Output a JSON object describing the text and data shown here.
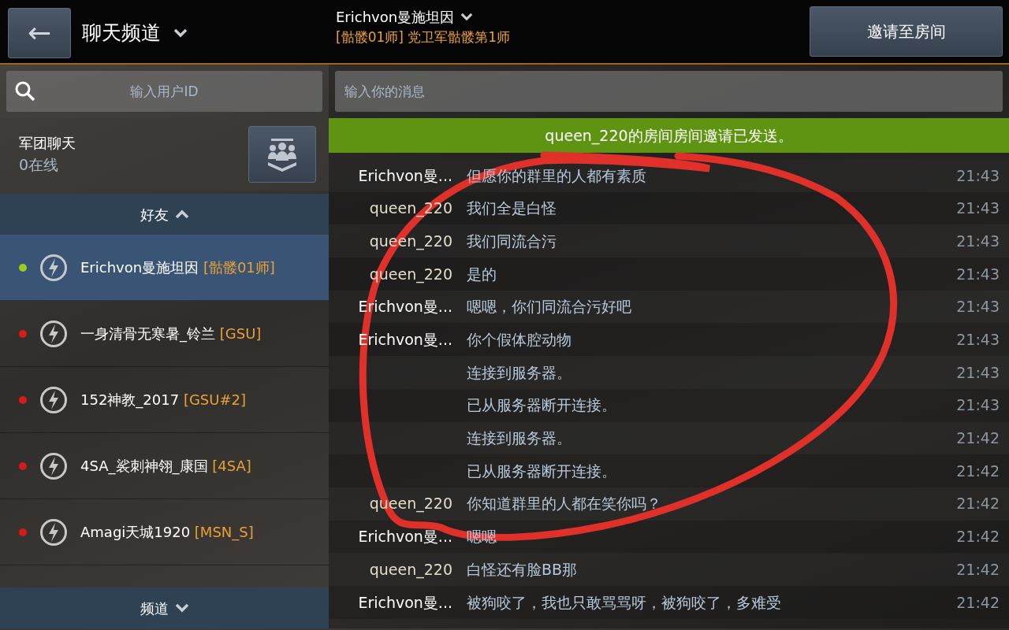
{
  "header": {
    "back": "←",
    "title": "聊天频道",
    "chat_partner": "Erichvon曼施坦因",
    "partner_clan": "[骷髅01师] 党卫军骷髅第1师",
    "invite_button": "邀请至房间"
  },
  "user_search": {
    "placeholder": "输入用户ID"
  },
  "message_field": {
    "placeholder": "输入你的消息"
  },
  "clan_chat": {
    "title": "军团聊天",
    "online": "0在线"
  },
  "friends_header": {
    "label": "好友",
    "expanded": true
  },
  "friends": [
    {
      "name": "Erichvon曼施坦因",
      "clan": "[骷髅01师]",
      "color": "#9ccc1c",
      "selected": true
    },
    {
      "name": "一身清骨无寒暑_铃兰",
      "clan": "[GSU]",
      "color": "#d71a1a",
      "selected": false
    },
    {
      "name": "152神教_2017",
      "clan": "[GSU#2]",
      "color": "#d71a1a",
      "selected": false
    },
    {
      "name": "4SA_裟刺神翎_康国",
      "clan": "[4SA]",
      "color": "#d71a1a",
      "selected": false
    },
    {
      "name": "Amagi天城1920",
      "clan": "[MSN_S]",
      "color": "#d71a1a",
      "selected": false
    }
  ],
  "channels_header": {
    "label": "频道",
    "expanded": false
  },
  "notice": "queen_220的房间房间邀请已发送。",
  "messages": [
    {
      "kind": "friend",
      "sender": "Erichvon曼...",
      "text": "但愿你的群里的人都有素质",
      "time": "21:43"
    },
    {
      "kind": "mine",
      "sender": "queen_220",
      "text": "我们全是白怪",
      "time": "21:43"
    },
    {
      "kind": "mine",
      "sender": "queen_220",
      "text": "我们同流合污",
      "time": "21:43"
    },
    {
      "kind": "mine",
      "sender": "queen_220",
      "text": "是的",
      "time": "21:43"
    },
    {
      "kind": "friend",
      "sender": "Erichvon曼...",
      "text": "嗯嗯，你们同流合污好吧",
      "time": "21:43"
    },
    {
      "kind": "friend",
      "sender": "Erichvon曼...",
      "text": "你个假体腔动物",
      "time": "21:43"
    },
    {
      "kind": "system",
      "text": "连接到服务器。",
      "time": "21:43"
    },
    {
      "kind": "system",
      "text": "已从服务器断开连接。",
      "time": "21:43"
    },
    {
      "kind": "system",
      "text": "连接到服务器。",
      "time": "21:42"
    },
    {
      "kind": "system",
      "text": "已从服务器断开连接。",
      "time": "21:42"
    },
    {
      "kind": "mine",
      "sender": "queen_220",
      "text": "你知道群里的人都在笑你吗？",
      "time": "21:42"
    },
    {
      "kind": "friend",
      "sender": "Erichvon曼...",
      "text": "嗯嗯",
      "time": "21:42"
    },
    {
      "kind": "mine",
      "sender": "queen_220",
      "text": "白怪还有脸BB那",
      "time": "21:42"
    },
    {
      "kind": "friend",
      "sender": "Erichvon曼...",
      "text": "被狗咬了，我也只敢骂骂呀，被狗咬了，多难受",
      "time": "21:42"
    }
  ]
}
